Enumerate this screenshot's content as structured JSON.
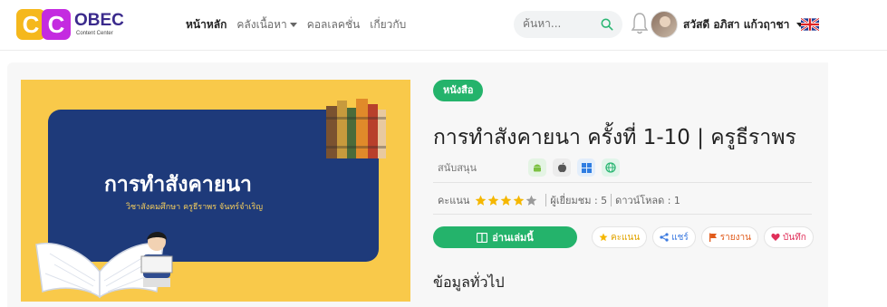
{
  "brand": {
    "logo_letters": [
      "C",
      "C"
    ],
    "name": "OBEC",
    "subtitle": "Content Center"
  },
  "nav": {
    "items": [
      {
        "label": "หน้าหลัก",
        "active": true
      },
      {
        "label": "คลังเนื้อหา",
        "dropdown": true
      },
      {
        "label": "คอลเลคชั่น"
      },
      {
        "label": "เกี่ยวกับ"
      }
    ]
  },
  "search": {
    "placeholder": "ค้นหา..."
  },
  "user": {
    "name": "สวัสดี อภิสา แก้วฤาชา"
  },
  "content": {
    "badge": "หนังสือ",
    "title": "การทำสังคายนา ครั้งที่ 1-10 | ครูธีราพร",
    "support_label": "สนับสนุน",
    "platforms": [
      "android-icon",
      "apple-icon",
      "windows-icon",
      "web-icon"
    ],
    "rating_label": "คะแนน",
    "rating_value": 4,
    "rating_max": 5,
    "views_text": "ผู้เยี่ยมชม : 5",
    "downloads_text": "ดาวน์โหลด : 1",
    "read_button": "อ่านเล่มนี้",
    "actions": {
      "rate": "คะแนน",
      "share": "แชร์",
      "report": "รายงาน",
      "save": "บันทึก"
    },
    "section_heading": "ข้อมูลทั่วไป"
  },
  "cover": {
    "title": "การทำสังคายนา",
    "subtitle": "วิชาสังคมศึกษา ครูธีราพร จันทร์จำเริญ"
  },
  "colors": {
    "accent_green": "#24b36b",
    "cover_yellow": "#f9c94a",
    "cover_navy": "#1e3a7a",
    "logo_yellow": "#f5b81c",
    "logo_purple": "#c42be0",
    "star": "#f5b700"
  }
}
